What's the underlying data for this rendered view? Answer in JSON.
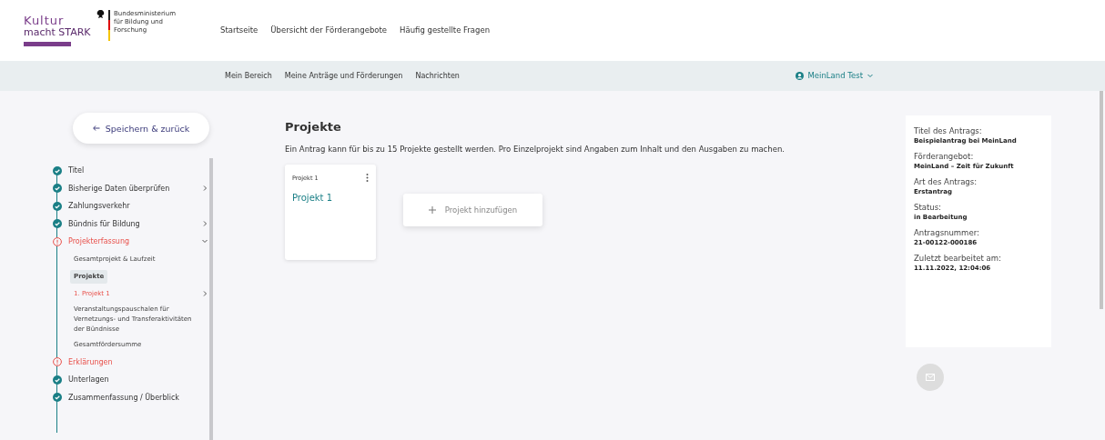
{
  "logo": {
    "line_1": "Kultur",
    "line_2": "macht STARK",
    "ministry": "Bundesministerium für Bildung und Forschung"
  },
  "top_nav": [
    {
      "label": "Startseite"
    },
    {
      "label": "Übersicht der Förderangebote"
    },
    {
      "label": "Häufig gestellte Fragen"
    }
  ],
  "sub_nav": [
    {
      "label": "Mein Bereich"
    },
    {
      "label": "Meine Anträge und Förderungen"
    },
    {
      "label": "Nachrichten"
    }
  ],
  "user_menu": {
    "label": "MeinLand Test"
  },
  "back_button": {
    "label": "Speichern & zurück"
  },
  "steps": [
    {
      "label": "Titel",
      "done": true,
      "expandable": false
    },
    {
      "label": "Bisherige Daten überprüfen",
      "done": true,
      "expandable": true,
      "expanded": false
    },
    {
      "label": "Zahlungsverkehr",
      "done": true,
      "expandable": false
    },
    {
      "label": "Bündnis für Bildung",
      "done": true,
      "expandable": true,
      "expanded": false
    },
    {
      "label": "Projekterfassung",
      "done": false,
      "expandable": true,
      "expanded": true,
      "children": [
        {
          "label": "Gesamtprojekt & Laufzeit",
          "selected": false,
          "error": false,
          "expandable": false
        },
        {
          "label": "Projekte",
          "selected": true,
          "error": false,
          "expandable": false
        },
        {
          "label": "1. Projekt 1",
          "selected": false,
          "error": true,
          "expandable": true
        },
        {
          "label": "Veranstaltungspauschalen für Vernetzungs- und Transferaktivitäten der Bündnisse",
          "selected": false,
          "error": false,
          "expandable": false
        },
        {
          "label": "Gesamtfördersumme",
          "selected": false,
          "error": false,
          "expandable": false
        }
      ]
    },
    {
      "label": "Erklärungen",
      "done": false,
      "expandable": false
    },
    {
      "label": "Unterlagen",
      "done": true,
      "expandable": false
    },
    {
      "label": "Zusammenfassung / Überblick",
      "done": true,
      "expandable": false
    }
  ],
  "main": {
    "title": "Projekte",
    "intro": "Ein Antrag kann für bis zu 15 Projekte gestellt werden. Pro Einzelprojekt sind Angaben zum Inhalt und den Ausgaben zu machen.",
    "projects": [
      {
        "caption": "Projekt 1",
        "name": "Projekt 1"
      }
    ],
    "add_button": {
      "label": "Projekt hinzufügen"
    }
  },
  "summary": [
    {
      "label": "Titel des Antrags:",
      "value": "Beispielantrag bei MeinLand"
    },
    {
      "label": "Förderangebot:",
      "value": "MeinLand – Zeit für Zukunft"
    },
    {
      "label": "Art des Antrags:",
      "value": "Erstantrag"
    },
    {
      "label": "Status:",
      "value": "in Bearbeitung"
    },
    {
      "label": "Antragsnummer:",
      "value": "21-00122-000186"
    },
    {
      "label": "Zuletzt bearbeitet am:",
      "value": "11.11.2022, 12:04:06"
    }
  ]
}
